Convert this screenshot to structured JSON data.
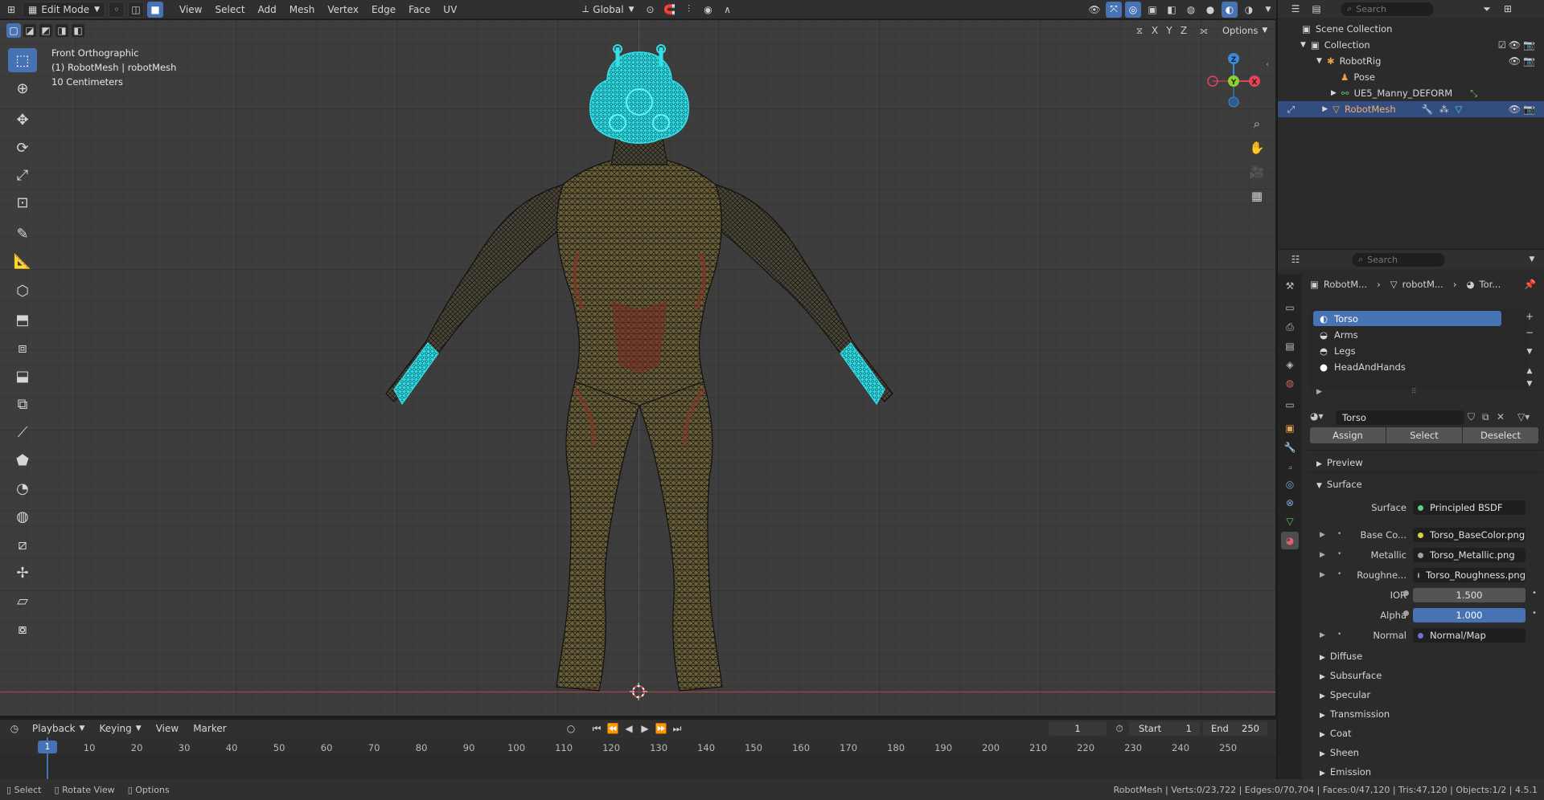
{
  "header": {
    "mode": "Edit Mode",
    "menus": [
      "View",
      "Select",
      "Add",
      "Mesh",
      "Vertex",
      "Edge",
      "Face",
      "UV"
    ],
    "transform_orientation": "Global",
    "search_placeholder": "Search"
  },
  "viewport": {
    "view_name": "Front Orthographic",
    "object_line": "(1) RobotMesh | robotMesh",
    "scale": "10 Centimeters",
    "options_label": "Options",
    "axis_labels": {
      "x": "X",
      "y": "Y",
      "z": "Z"
    }
  },
  "outliner": {
    "search_placeholder": "Search",
    "rows": [
      {
        "label": "Scene Collection",
        "indent": 0
      },
      {
        "label": "Collection",
        "indent": 1
      },
      {
        "label": "RobotRig",
        "indent": 2
      },
      {
        "label": "Pose",
        "indent": 3
      },
      {
        "label": "UE5_Manny_DEFORM",
        "indent": 3
      },
      {
        "label": "RobotMesh",
        "indent": 2
      }
    ]
  },
  "properties": {
    "search_placeholder": "Search",
    "breadcrumb": [
      "RobotM...",
      "robotM...",
      "Tor..."
    ],
    "material_slots": [
      "Torso",
      "Arms",
      "Legs",
      "HeadAndHands"
    ],
    "material_name": "Torso",
    "buttons": {
      "assign": "Assign",
      "select": "Select",
      "deselect": "Deselect"
    },
    "panels": {
      "preview": "Preview",
      "surface": "Surface"
    },
    "surface": {
      "surface_label": "Surface",
      "surface_value": "Principled BSDF",
      "base_color_label": "Base Co...",
      "base_color_value": "Torso_BaseColor.png",
      "metallic_label": "Metallic",
      "metallic_value": "Torso_Metallic.png",
      "roughness_label": "Roughne...",
      "roughness_value": "Torso_Roughness.png",
      "ior_label": "IOR",
      "ior_value": "1.500",
      "alpha_label": "Alpha",
      "alpha_value": "1.000",
      "normal_label": "Normal",
      "normal_value": "Normal/Map"
    },
    "subpanels": [
      "Diffuse",
      "Subsurface",
      "Specular",
      "Transmission",
      "Coat",
      "Sheen",
      "Emission"
    ]
  },
  "timeline": {
    "menus": [
      "Playback",
      "Keying",
      "View",
      "Marker"
    ],
    "current_frame": "1",
    "start_label": "Start",
    "start_value": "1",
    "end_label": "End",
    "end_value": "250",
    "ruler": [
      "1",
      "10",
      "20",
      "30",
      "40",
      "50",
      "60",
      "70",
      "80",
      "90",
      "100",
      "110",
      "120",
      "130",
      "140",
      "150",
      "160",
      "170",
      "180",
      "190",
      "200",
      "210",
      "220",
      "230",
      "240",
      "250"
    ]
  },
  "statusbar": {
    "left": [
      "Select",
      "Rotate View",
      "Options"
    ],
    "right": "RobotMesh | Verts:0/23,722 | Edges:0/70,704 | Faces:0/47,120 | Tris:47,120 | Objects:1/2 | 4.5.1"
  },
  "colors": {
    "accent": "#4772b3",
    "selection_cyan": "#33e0e8",
    "header_bg": "#303030",
    "panel_bg": "#2b2b2b"
  }
}
